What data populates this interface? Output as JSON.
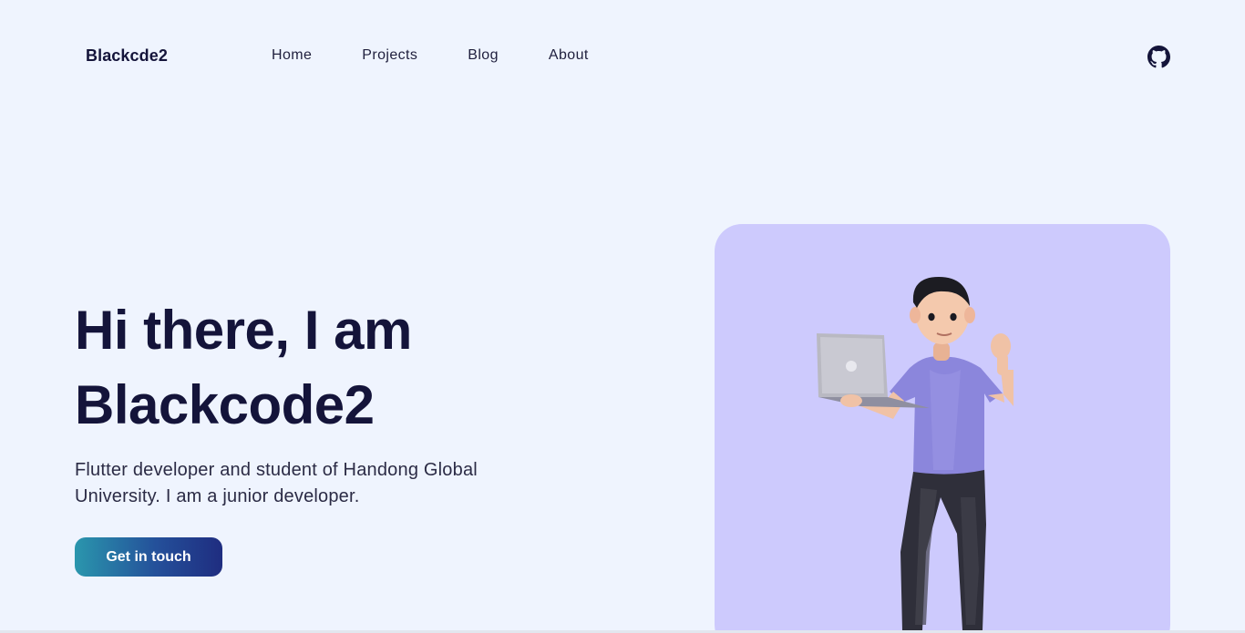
{
  "header": {
    "brand": "Blackcde2",
    "nav": [
      {
        "label": "Home"
      },
      {
        "label": "Projects"
      },
      {
        "label": "Blog"
      },
      {
        "label": "About"
      }
    ],
    "github_icon": "github-icon"
  },
  "hero": {
    "title_line1": "Hi there, I am",
    "title_line2": "Blackcode2",
    "subtitle": "Flutter developer and student of Handong Global University. I am a junior developer.",
    "cta_label": "Get in touch"
  },
  "colors": {
    "background": "#eff4fe",
    "text": "#14143a",
    "card": "#cdcafd",
    "cta_gradient_start": "#2a96ad",
    "cta_gradient_end": "#1f2d80"
  }
}
